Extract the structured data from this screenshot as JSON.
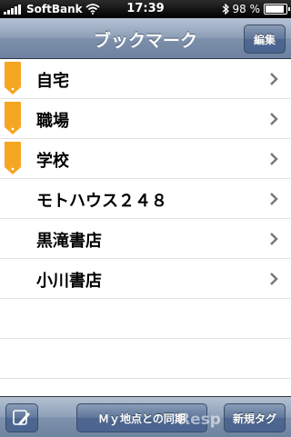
{
  "status_bar": {
    "carrier": "SoftBank",
    "time": "17:39",
    "battery_percent_label": "98 %",
    "battery_level": 0.98,
    "icons": [
      "signal-bars-icon",
      "wifi-icon",
      "bluetooth-icon",
      "battery-icon"
    ]
  },
  "nav": {
    "title": "ブックマーク",
    "edit_label": "編集"
  },
  "bookmarks": [
    {
      "label": "自宅",
      "tagged": true
    },
    {
      "label": "職場",
      "tagged": true
    },
    {
      "label": "学校",
      "tagged": true
    },
    {
      "label": "モトハウス２４８",
      "tagged": false
    },
    {
      "label": "黒滝書店",
      "tagged": false
    },
    {
      "label": "小川書店",
      "tagged": false
    }
  ],
  "toolbar": {
    "sync_label": "Ｍｙ地点との同期",
    "new_tag_label": "新規タグ",
    "left_icon": "edit-pen-icon"
  },
  "watermark": "Resp",
  "colors": {
    "tag": "#f5a623",
    "nav_bar": "#8b9db5",
    "chevron": "#7a7a7a"
  }
}
